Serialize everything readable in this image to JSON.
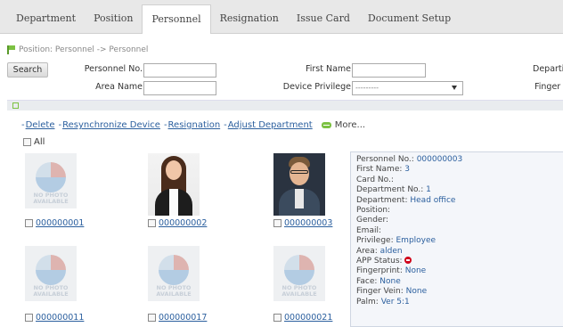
{
  "nav": {
    "tabs": [
      {
        "label": "Department"
      },
      {
        "label": "Position"
      },
      {
        "label": "Personnel",
        "active": true
      },
      {
        "label": "Resignation"
      },
      {
        "label": "Issue Card"
      },
      {
        "label": "Document Setup"
      }
    ]
  },
  "breadcrumb": "Position: Personnel -> Personnel",
  "search": {
    "button": "Search",
    "personnel_no_label": "Personnel No.",
    "first_name_label": "First Name",
    "department_label": "Departi",
    "area_name_label": "Area Name",
    "device_privilege_label": "Device Privilege",
    "device_privilege_value": "---------",
    "finger_label": "Finger"
  },
  "actions": {
    "delete": "Delete",
    "resync": "Resynchronize Device",
    "resignation": "Resignation",
    "adjust": "Adjust Department",
    "more": "More..."
  },
  "select_all": "All",
  "placeholder_text": {
    "line1": "NO PHOTO",
    "line2": "AVAILABLE"
  },
  "cards": [
    {
      "id": "000000001",
      "photo": "placeholder"
    },
    {
      "id": "000000002",
      "photo": "woman"
    },
    {
      "id": "000000003",
      "photo": "man"
    },
    {
      "id": "000000011",
      "photo": "placeholder"
    },
    {
      "id": "000000017",
      "photo": "placeholder"
    },
    {
      "id": "000000021",
      "photo": "placeholder"
    }
  ],
  "detail": {
    "personnel_no": {
      "label": "Personnel No.:",
      "value": "000000003"
    },
    "first_name": {
      "label": "First Name:",
      "value": "3"
    },
    "card_no": {
      "label": "Card No.:",
      "value": ""
    },
    "department_no": {
      "label": "Department No.:",
      "value": "1"
    },
    "department": {
      "label": "Department:",
      "value": "Head office"
    },
    "position": {
      "label": "Position:",
      "value": ""
    },
    "gender": {
      "label": "Gender:",
      "value": ""
    },
    "email": {
      "label": "Email:",
      "value": ""
    },
    "privilege": {
      "label": "Privilege:",
      "value": "Employee"
    },
    "area": {
      "label": "Area:",
      "value": "alden"
    },
    "app_status": {
      "label": "APP Status:"
    },
    "fingerprint": {
      "label": "Fingerprint:",
      "value": "None"
    },
    "face": {
      "label": "Face:",
      "value": "None"
    },
    "finger_vein": {
      "label": "Finger Vein:",
      "value": "None"
    },
    "palm": {
      "label": "Palm:",
      "value": "Ver 5:1"
    }
  },
  "colors": {
    "link": "#2b5f9e",
    "accent_green": "#7cc142",
    "status_red": "#d0021b"
  }
}
